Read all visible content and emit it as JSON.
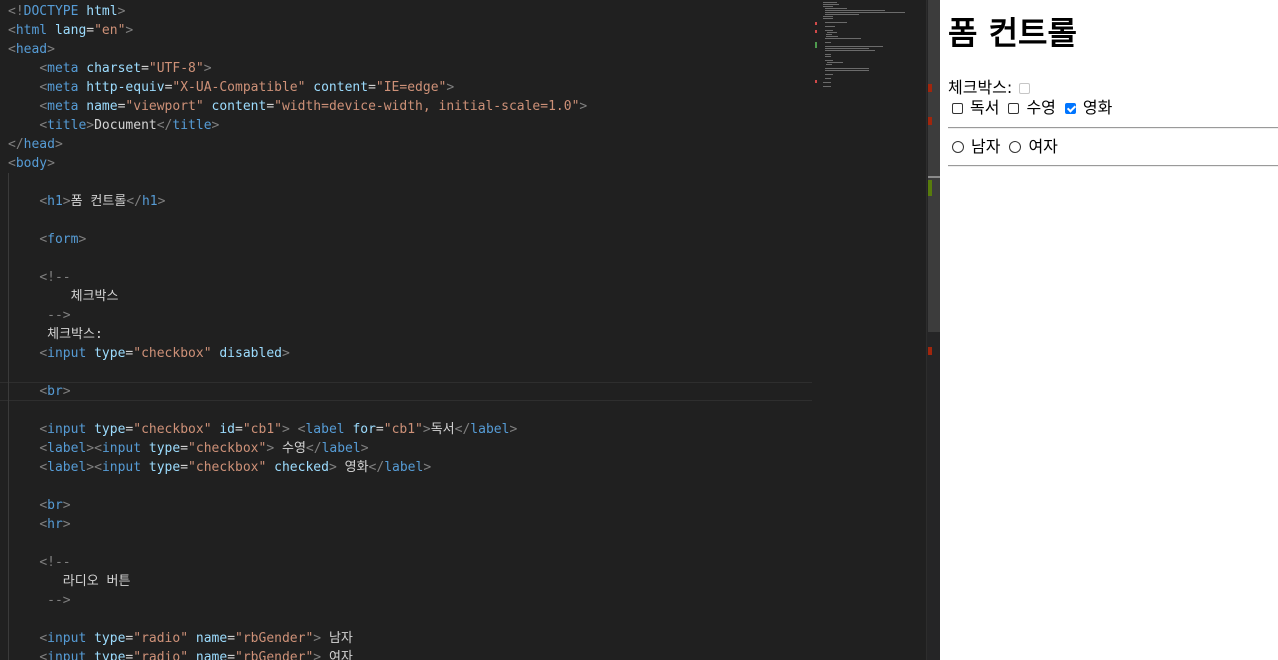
{
  "editor": {
    "lines": [
      [
        [
          "p",
          "<!"
        ],
        [
          "t",
          "DOCTYPE"
        ],
        [
          "x",
          " "
        ],
        [
          "a",
          "html"
        ],
        [
          "p",
          ">"
        ]
      ],
      [
        [
          "p",
          "<"
        ],
        [
          "t",
          "html"
        ],
        [
          "x",
          " "
        ],
        [
          "a",
          "lang"
        ],
        [
          "x",
          "="
        ],
        [
          "s",
          "\"en\""
        ],
        [
          "p",
          ">"
        ]
      ],
      [
        [
          "p",
          "<"
        ],
        [
          "t",
          "head"
        ],
        [
          "p",
          ">"
        ]
      ],
      [
        [
          "x",
          "    "
        ],
        [
          "p",
          "<"
        ],
        [
          "t",
          "meta"
        ],
        [
          "x",
          " "
        ],
        [
          "a",
          "charset"
        ],
        [
          "x",
          "="
        ],
        [
          "s",
          "\"UTF-8\""
        ],
        [
          "p",
          ">"
        ]
      ],
      [
        [
          "x",
          "    "
        ],
        [
          "p",
          "<"
        ],
        [
          "t",
          "meta"
        ],
        [
          "x",
          " "
        ],
        [
          "a",
          "http-equiv"
        ],
        [
          "x",
          "="
        ],
        [
          "s",
          "\"X-UA-Compatible\""
        ],
        [
          "x",
          " "
        ],
        [
          "a",
          "content"
        ],
        [
          "x",
          "="
        ],
        [
          "s",
          "\"IE=edge\""
        ],
        [
          "p",
          ">"
        ]
      ],
      [
        [
          "x",
          "    "
        ],
        [
          "p",
          "<"
        ],
        [
          "t",
          "meta"
        ],
        [
          "x",
          " "
        ],
        [
          "a",
          "name"
        ],
        [
          "x",
          "="
        ],
        [
          "s",
          "\"viewport\""
        ],
        [
          "x",
          " "
        ],
        [
          "a",
          "content"
        ],
        [
          "x",
          "="
        ],
        [
          "s",
          "\"width=device-width, initial-scale=1.0\""
        ],
        [
          "p",
          ">"
        ]
      ],
      [
        [
          "x",
          "    "
        ],
        [
          "p",
          "<"
        ],
        [
          "t",
          "title"
        ],
        [
          "p",
          ">"
        ],
        [
          "x",
          "Document"
        ],
        [
          "p",
          "</"
        ],
        [
          "t",
          "title"
        ],
        [
          "p",
          ">"
        ]
      ],
      [
        [
          "p",
          "</"
        ],
        [
          "t",
          "head"
        ],
        [
          "p",
          ">"
        ]
      ],
      [
        [
          "p",
          "<"
        ],
        [
          "t",
          "body"
        ],
        [
          "p",
          ">"
        ]
      ],
      [
        [
          "x",
          ""
        ]
      ],
      [
        [
          "x",
          "    "
        ],
        [
          "p",
          "<"
        ],
        [
          "t",
          "h1"
        ],
        [
          "p",
          ">"
        ],
        [
          "x",
          "폼 컨트롤"
        ],
        [
          "p",
          "</"
        ],
        [
          "t",
          "h1"
        ],
        [
          "p",
          ">"
        ]
      ],
      [
        [
          "x",
          ""
        ]
      ],
      [
        [
          "x",
          "    "
        ],
        [
          "p",
          "<"
        ],
        [
          "t",
          "form"
        ],
        [
          "p",
          ">"
        ]
      ],
      [
        [
          "x",
          ""
        ]
      ],
      [
        [
          "x",
          "    "
        ],
        [
          "p",
          "<!--"
        ]
      ],
      [
        [
          "x",
          "        "
        ],
        [
          "x",
          "체크박스"
        ]
      ],
      [
        [
          "x",
          "     "
        ],
        [
          "p",
          "-->"
        ]
      ],
      [
        [
          "x",
          "     "
        ],
        [
          "x",
          "체크박스:"
        ]
      ],
      [
        [
          "x",
          "    "
        ],
        [
          "p",
          "<"
        ],
        [
          "t",
          "input"
        ],
        [
          "x",
          " "
        ],
        [
          "a",
          "type"
        ],
        [
          "x",
          "="
        ],
        [
          "s",
          "\"checkbox\""
        ],
        [
          "x",
          " "
        ],
        [
          "a",
          "disabled"
        ],
        [
          "p",
          ">"
        ]
      ],
      [
        [
          "x",
          ""
        ]
      ],
      [
        [
          "x",
          "    "
        ],
        [
          "p",
          "<"
        ],
        [
          "t",
          "br"
        ],
        [
          "p",
          ">"
        ]
      ],
      [
        [
          "x",
          ""
        ]
      ],
      [
        [
          "x",
          "    "
        ],
        [
          "p",
          "<"
        ],
        [
          "t",
          "input"
        ],
        [
          "x",
          " "
        ],
        [
          "a",
          "type"
        ],
        [
          "x",
          "="
        ],
        [
          "s",
          "\"checkbox\""
        ],
        [
          "x",
          " "
        ],
        [
          "a",
          "id"
        ],
        [
          "x",
          "="
        ],
        [
          "s",
          "\"cb1\""
        ],
        [
          "p",
          ">"
        ],
        [
          "x",
          " "
        ],
        [
          "p",
          "<"
        ],
        [
          "t",
          "label"
        ],
        [
          "x",
          " "
        ],
        [
          "a",
          "for"
        ],
        [
          "x",
          "="
        ],
        [
          "s",
          "\"cb1\""
        ],
        [
          "p",
          ">"
        ],
        [
          "x",
          "독서"
        ],
        [
          "p",
          "</"
        ],
        [
          "t",
          "label"
        ],
        [
          "p",
          ">"
        ]
      ],
      [
        [
          "x",
          "    "
        ],
        [
          "p",
          "<"
        ],
        [
          "t",
          "label"
        ],
        [
          "p",
          "><"
        ],
        [
          "t",
          "input"
        ],
        [
          "x",
          " "
        ],
        [
          "a",
          "type"
        ],
        [
          "x",
          "="
        ],
        [
          "s",
          "\"checkbox\""
        ],
        [
          "p",
          ">"
        ],
        [
          "x",
          " 수영"
        ],
        [
          "p",
          "</"
        ],
        [
          "t",
          "label"
        ],
        [
          "p",
          ">"
        ]
      ],
      [
        [
          "x",
          "    "
        ],
        [
          "p",
          "<"
        ],
        [
          "t",
          "label"
        ],
        [
          "p",
          "><"
        ],
        [
          "t",
          "input"
        ],
        [
          "x",
          " "
        ],
        [
          "a",
          "type"
        ],
        [
          "x",
          "="
        ],
        [
          "s",
          "\"checkbox\""
        ],
        [
          "x",
          " "
        ],
        [
          "a",
          "checked"
        ],
        [
          "p",
          ">"
        ],
        [
          "x",
          " 영화"
        ],
        [
          "p",
          "</"
        ],
        [
          "t",
          "label"
        ],
        [
          "p",
          ">"
        ]
      ],
      [
        [
          "x",
          ""
        ]
      ],
      [
        [
          "x",
          "    "
        ],
        [
          "p",
          "<"
        ],
        [
          "t",
          "br"
        ],
        [
          "p",
          ">"
        ]
      ],
      [
        [
          "x",
          "    "
        ],
        [
          "p",
          "<"
        ],
        [
          "t",
          "hr"
        ],
        [
          "p",
          ">"
        ]
      ],
      [
        [
          "x",
          ""
        ]
      ],
      [
        [
          "x",
          "    "
        ],
        [
          "p",
          "<!--"
        ]
      ],
      [
        [
          "x",
          "       "
        ],
        [
          "x",
          "라디오 버튼"
        ]
      ],
      [
        [
          "x",
          "     "
        ],
        [
          "p",
          "-->"
        ]
      ],
      [
        [
          "x",
          ""
        ]
      ],
      [
        [
          "x",
          "    "
        ],
        [
          "p",
          "<"
        ],
        [
          "t",
          "input"
        ],
        [
          "x",
          " "
        ],
        [
          "a",
          "type"
        ],
        [
          "x",
          "="
        ],
        [
          "s",
          "\"radio\""
        ],
        [
          "x",
          " "
        ],
        [
          "a",
          "name"
        ],
        [
          "x",
          "="
        ],
        [
          "s",
          "\"rbGender\""
        ],
        [
          "p",
          ">"
        ],
        [
          "x",
          " 남자"
        ]
      ],
      [
        [
          "x",
          "    "
        ],
        [
          "p",
          "<"
        ],
        [
          "t",
          "input"
        ],
        [
          "x",
          " "
        ],
        [
          "a",
          "type"
        ],
        [
          "x",
          "="
        ],
        [
          "s",
          "\"radio\""
        ],
        [
          "x",
          " "
        ],
        [
          "a",
          "name"
        ],
        [
          "x",
          "="
        ],
        [
          "s",
          "\"rbGender\""
        ],
        [
          "p",
          ">"
        ],
        [
          "x",
          " 여자"
        ]
      ]
    ],
    "current_line": 20
  },
  "preview": {
    "heading": "폼 컨트롤",
    "disabled_label": "체크박스:",
    "checkboxes": [
      {
        "label": "독서",
        "checked": false
      },
      {
        "label": "수영",
        "checked": false
      },
      {
        "label": "영화",
        "checked": true
      }
    ],
    "radios": [
      {
        "label": "남자",
        "checked": false
      },
      {
        "label": "여자",
        "checked": false
      }
    ]
  },
  "colors": {
    "editor_bg": "#202020",
    "tag": "#569cd6",
    "attribute": "#9cdcfe",
    "string": "#ce9178",
    "checkbox_accent": "#0075ff"
  }
}
